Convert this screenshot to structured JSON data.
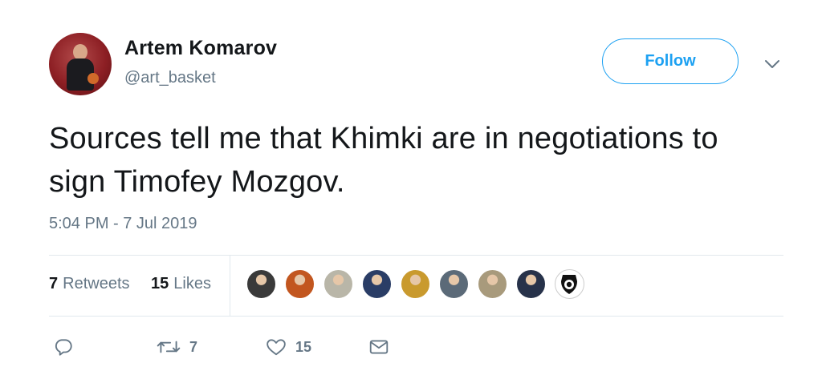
{
  "author": {
    "name": "Artem Komarov",
    "handle": "@art_basket",
    "avatar_color": "#8d1f24"
  },
  "follow_button": {
    "label": "Follow",
    "color": "#1da1f2"
  },
  "menu_icon": "chevron-down-icon",
  "tweet": {
    "text": "Sources tell me that Khimki are in negotiations to sign Timofey Mozgov.",
    "timestamp": "5:04 PM - 7 Jul 2019"
  },
  "stats": {
    "retweets_count": "7",
    "retweets_label": "Retweets",
    "likes_count": "15",
    "likes_label": "Likes"
  },
  "liker_avatars": [
    {
      "name": "liker-avatar-1",
      "color": "#3a3a3a"
    },
    {
      "name": "liker-avatar-2",
      "color": "#c2561f"
    },
    {
      "name": "liker-avatar-3",
      "color": "#b9b6a8"
    },
    {
      "name": "liker-avatar-4",
      "color": "#2a3d66"
    },
    {
      "name": "liker-avatar-5",
      "color": "#c99a2e"
    },
    {
      "name": "liker-avatar-6",
      "color": "#5b6a78"
    },
    {
      "name": "liker-avatar-7",
      "color": "#a89a7c"
    },
    {
      "name": "liker-avatar-8",
      "color": "#27324a"
    },
    {
      "name": "liker-avatar-9",
      "color": "#ffffff"
    }
  ],
  "actions": {
    "reply_icon": "reply-icon",
    "retweet_icon": "retweet-icon",
    "retweet_count": "7",
    "like_icon": "heart-icon",
    "like_count": "15",
    "dm_icon": "envelope-icon"
  }
}
